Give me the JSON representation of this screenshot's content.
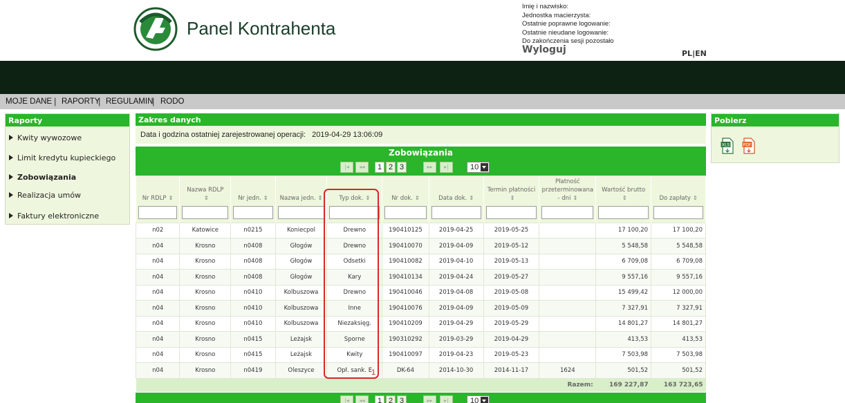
{
  "header": {
    "title": "Panel Kontrahenta",
    "user_info": [
      "Imię i nazwisko:",
      "Jednostka macierzysta:",
      "Ostatnie poprawne logowanie:",
      "Ostatnie nieudane logowanie:",
      "Do zakończenia sesji pozostało"
    ],
    "logout": "Wyloguj",
    "lang": "PL|EN"
  },
  "menu": [
    "MOJE DANE",
    "RAPORTY",
    "REGULAMIN",
    "RODO"
  ],
  "sidebar": {
    "title": "Raporty",
    "items": [
      {
        "label": "Kwity wywozowe",
        "active": false
      },
      {
        "label": "Limit kredytu kupieckiego",
        "active": false
      },
      {
        "label": "Zobowiązania",
        "active": true
      },
      {
        "label": "Realizacja umów",
        "active": false
      },
      {
        "label": "Faktury elektroniczne",
        "active": false
      }
    ]
  },
  "download": {
    "title": "Pobierz",
    "icons": [
      "xls-icon",
      "pdf-icon"
    ]
  },
  "main": {
    "section_title": "Zakres danych",
    "last_operation_label": "Data i godzina ostatniej zarejestrowanej operacji:",
    "last_operation_value": "2019-04-29 13:06:09",
    "grid_title": "Zobowiązania",
    "pager": {
      "pages": [
        "1",
        "2",
        "3"
      ],
      "current": "1",
      "page_size": "10"
    },
    "columns": [
      [
        "Nr RDLP"
      ],
      [
        "Nazwa RDLP"
      ],
      [
        "Nr jedn."
      ],
      [
        "Nazwa jedn."
      ],
      [
        "Typ dok."
      ],
      [
        "Nr dok."
      ],
      [
        "Data dok."
      ],
      [
        "Termin płatności"
      ],
      [
        "Płatność",
        "przeterminowana",
        "- dni"
      ],
      [
        "Wartość brutto"
      ],
      [
        "Do zapłaty"
      ]
    ],
    "rows": [
      [
        "n02",
        "Katowice",
        "n0215",
        "Koniecpol",
        "Drewno",
        "190410125",
        "2019-04-25",
        "2019-05-25",
        "",
        "17 100,20",
        "17 100,20"
      ],
      [
        "n04",
        "Krosno",
        "n0408",
        "Głogów",
        "Drewno",
        "190410070",
        "2019-04-09",
        "2019-05-12",
        "",
        "5 548,58",
        "5 548,58"
      ],
      [
        "n04",
        "Krosno",
        "n0408",
        "Głogów",
        "Odsetki",
        "190410082",
        "2019-04-10",
        "2019-05-13",
        "",
        "6 709,08",
        "6 709,08"
      ],
      [
        "n04",
        "Krosno",
        "n0408",
        "Głogów",
        "Kary",
        "190410134",
        "2019-04-24",
        "2019-05-27",
        "",
        "9 557,16",
        "9 557,16"
      ],
      [
        "n04",
        "Krosno",
        "n0410",
        "Kolbuszowa",
        "Drewno",
        "190410046",
        "2019-04-08",
        "2019-05-08",
        "",
        "15 499,42",
        "12 000,00"
      ],
      [
        "n04",
        "Krosno",
        "n0410",
        "Kolbuszowa",
        "Inne",
        "190410076",
        "2019-04-09",
        "2019-05-09",
        "",
        "7 327,91",
        "7 327,91"
      ],
      [
        "n04",
        "Krosno",
        "n0410",
        "Kolbuszowa",
        "Niezaksięg.",
        "190410209",
        "2019-04-29",
        "2019-05-29",
        "",
        "14 801,27",
        "14 801,27"
      ],
      [
        "n04",
        "Krosno",
        "n0415",
        "Leżajsk",
        "Sporne",
        "190310292",
        "2019-03-29",
        "2019-04-29",
        "",
        "413,53",
        "413,53"
      ],
      [
        "n04",
        "Krosno",
        "n0415",
        "Leżajsk",
        "Kwity",
        "190410097",
        "2019-04-23",
        "2019-05-23",
        "",
        "7 503,98",
        "7 503,98"
      ],
      [
        "n04",
        "Krosno",
        "n0419",
        "Oleszyce",
        "Opł. sank. E",
        "DK-64",
        "2014-10-30",
        "2014-11-17",
        "1624",
        "501,52",
        "501,52"
      ]
    ],
    "totals": {
      "label": "Razem:",
      "gross": "169 227,87",
      "to_pay": "163 723,65"
    },
    "annotation_number": "1"
  },
  "colors": {
    "green": "#2ab52a",
    "light_green": "#eef7dd",
    "dark_bar": "#0d2212",
    "highlight": "#d62828"
  }
}
